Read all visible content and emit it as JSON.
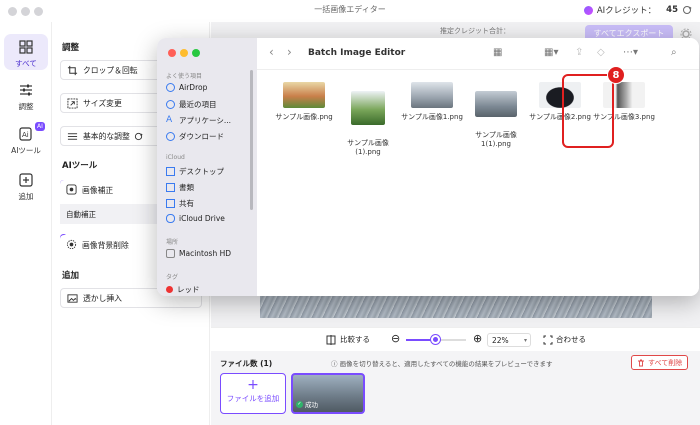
{
  "app": {
    "title": "一括画像エディター",
    "credit_label": "AIクレジット：",
    "credit_value": "45",
    "estimate_label": "推定クレジット合計：",
    "export_label": "すべてエクスポート"
  },
  "rail": {
    "items": [
      {
        "label": "すべて",
        "icon": "grid-icon"
      },
      {
        "label": "調整",
        "icon": "sliders-icon"
      },
      {
        "label": "AIツール",
        "icon": "ai-icon"
      },
      {
        "label": "追加",
        "icon": "plus-square-icon"
      }
    ],
    "ai_badge": "AI"
  },
  "panel": {
    "adjust_title": "調整",
    "crop": "クロップ＆回転",
    "resize": "サイズ変更",
    "basic": "基本的な調整",
    "ai_title": "AIツール",
    "enhance": "画像補正",
    "auto_enhance": "自動補正",
    "bg_remove": "画像背景削除",
    "add_title": "追加",
    "watermark": "透かし挿入"
  },
  "zoombar": {
    "compare": "比較する",
    "zoom": "22%",
    "fit": "合わせる",
    "zoom_level": 0.22
  },
  "filebar": {
    "count": "ファイル数 (1)",
    "note": "画像を切り替えると、適用したすべての機能の結果をプレビューできます",
    "delete_all": "すべて削除",
    "add_file": "ファイルを追加",
    "status": "成功"
  },
  "finder": {
    "title": "Batch Image Editor",
    "sidebar": {
      "favorites_label": "よく使う項目",
      "favorites": [
        "AirDrop",
        "最近の項目",
        "アプリケーシ...",
        "ダウンロード"
      ],
      "icloud_label": "iCloud",
      "icloud": [
        "デスクトップ",
        "書類",
        "共有",
        "iCloud Drive"
      ],
      "location_label": "場所",
      "locations": [
        "Macintosh HD"
      ],
      "tags_label": "タグ",
      "tags": [
        "レッド"
      ]
    },
    "files": [
      {
        "name": "サンプル画像.png"
      },
      {
        "name": "サンプル画像\n(1).png"
      },
      {
        "name": "サンプル画像1.png"
      },
      {
        "name": "サンプル画像\n1(1).png"
      },
      {
        "name": "サンプル画像2.png"
      },
      {
        "name": "サンプル画像3.png"
      }
    ]
  },
  "annotation": {
    "step": "8"
  },
  "colors": {
    "accent": "#7a4cff",
    "danger": "#e02020"
  }
}
